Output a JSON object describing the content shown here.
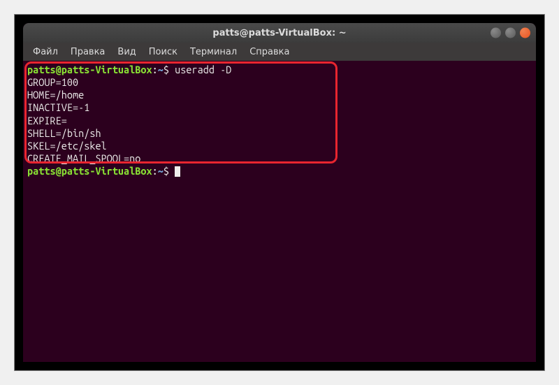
{
  "window": {
    "title": "patts@patts-VirtualBox: ~"
  },
  "menubar": {
    "items": [
      {
        "label": "Файл"
      },
      {
        "label": "Правка"
      },
      {
        "label": "Вид"
      },
      {
        "label": "Поиск"
      },
      {
        "label": "Терминал"
      },
      {
        "label": "Справка"
      }
    ]
  },
  "terminal": {
    "prompt_user": "patts@patts-VirtualBox",
    "prompt_sep": ":",
    "prompt_path": "~",
    "prompt_end": "$ ",
    "command": "useradd -D",
    "output": [
      "GROUP=100",
      "HOME=/home",
      "INACTIVE=-1",
      "EXPIRE=",
      "SHELL=/bin/sh",
      "SKEL=/etc/skel",
      "CREATE_MAIL_SPOOL=no"
    ]
  }
}
